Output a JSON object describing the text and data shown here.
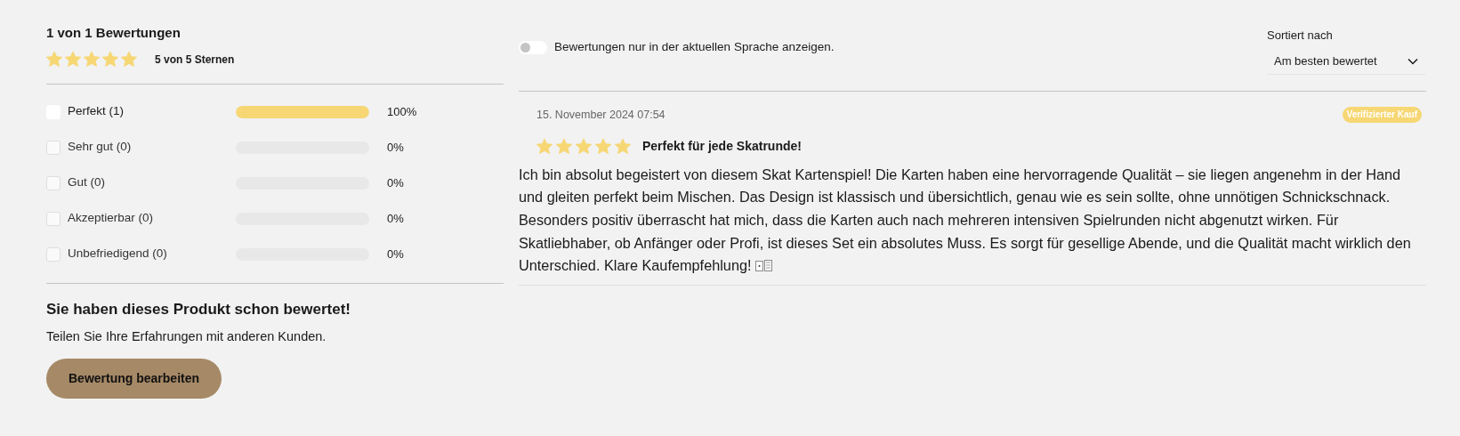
{
  "summary": {
    "title": "1 von 1 Bewertungen",
    "stars": 5,
    "stars_label": "5 von 5 Sternen"
  },
  "breakdown": [
    {
      "label": "Perfekt (1)",
      "disabled": false,
      "level": 1,
      "percent": "100%"
    },
    {
      "label": "Sehr gut (0)",
      "disabled": true,
      "level": 0,
      "percent": "0%"
    },
    {
      "label": "Gut (0)",
      "disabled": true,
      "level": 0,
      "percent": "0%"
    },
    {
      "label": "Akzeptierbar (0)",
      "disabled": true,
      "level": 0,
      "percent": "0%"
    },
    {
      "label": "Unbefriedigend (0)",
      "disabled": true,
      "level": 0,
      "percent": "0%"
    }
  ],
  "already_rated": {
    "title": "Sie haben dieses Produkt schon bewertet!",
    "text": "Teilen Sie Ihre Erfahrungen mit anderen Kunden.",
    "button": "Bewertung bearbeiten"
  },
  "language_filter": {
    "label": "Bewertungen nur in der aktuellen Sprache anzeigen.",
    "on": false
  },
  "sort": {
    "label": "Sortiert nach",
    "value": "Am besten bewertet"
  },
  "reviews": [
    {
      "date": "15. November 2024 07:54",
      "badge": "Verifizierter Kauf",
      "stars": 5,
      "title": "Perfekt für jede Skatrunde!",
      "text": "Ich bin absolut begeistert von diesem Skat Kartenspiel! Die Karten haben eine hervorragende Qualität – sie liegen angenehm in der Hand und gleiten perfekt beim Mischen. Das Design ist klassisch und übersichtlich, genau wie es sein sollte, ohne unnötigen Schnickschnack. Besonders positiv überrascht hat mich, dass die Karten auch nach mehreren intensiven Spielrunden nicht abgenutzt wirken. Für Skatliebhaber, ob Anfänger oder Profi, ist dieses Set ein absolutes Muss. Es sorgt für gesellige Abende, und die Qualität macht wirklich den Unterschied. Klare Kaufempfehlung!"
    }
  ]
}
